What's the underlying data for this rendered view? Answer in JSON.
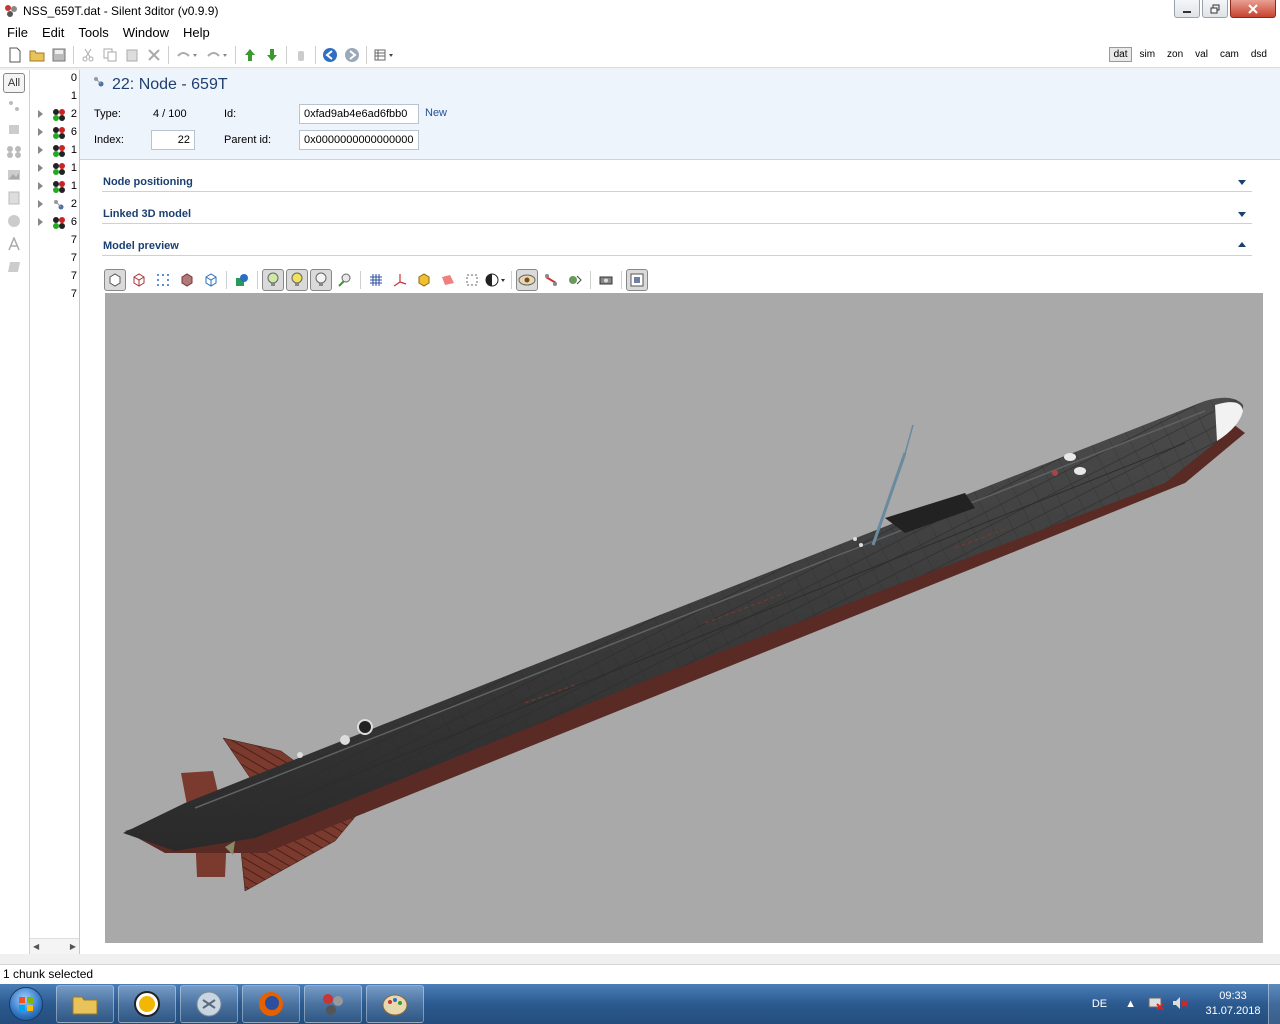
{
  "window": {
    "title": "NSS_659T.dat - Silent 3ditor (v0.9.9)"
  },
  "menu": [
    "File",
    "Edit",
    "Tools",
    "Window",
    "Help"
  ],
  "view_tabs": [
    "dat",
    "sim",
    "zon",
    "val",
    "cam",
    "dsd"
  ],
  "active_view_tab": "dat",
  "left_strip": {
    "all_label": "All"
  },
  "tree": {
    "rows": [
      {
        "label": "0"
      },
      {
        "label": "1"
      },
      {
        "label": "2"
      },
      {
        "label": "6"
      },
      {
        "label": "1"
      },
      {
        "label": "1"
      },
      {
        "label": "1"
      },
      {
        "label": "2"
      },
      {
        "label": "6"
      },
      {
        "label": "7"
      },
      {
        "label": "7"
      },
      {
        "label": "7"
      },
      {
        "label": "7"
      }
    ]
  },
  "node": {
    "title": "22: Node - 659T",
    "type_label": "Type:",
    "type_value": "4 / 100",
    "id_label": "Id:",
    "id_value": "0xfad9ab4e6ad6fbb0",
    "new_link": "New",
    "index_label": "Index:",
    "index_value": "22",
    "parent_label": "Parent id:",
    "parent_value": "0x0000000000000000"
  },
  "sections": [
    {
      "label": "Node positioning",
      "state": "collapsed"
    },
    {
      "label": "Linked 3D model",
      "state": "collapsed"
    },
    {
      "label": "Model preview",
      "state": "expanded"
    }
  ],
  "status": {
    "text": "1 chunk selected"
  },
  "taskbar": {
    "language": "DE",
    "time": "09:33",
    "date": "31.07.2018"
  },
  "colors": {
    "viewport_bg": "#a9a9a9",
    "header_bg": "#eef4fb",
    "section_text": "#1b3f73",
    "hull": "#3a3a3a",
    "fins": "#7a3a2e"
  }
}
